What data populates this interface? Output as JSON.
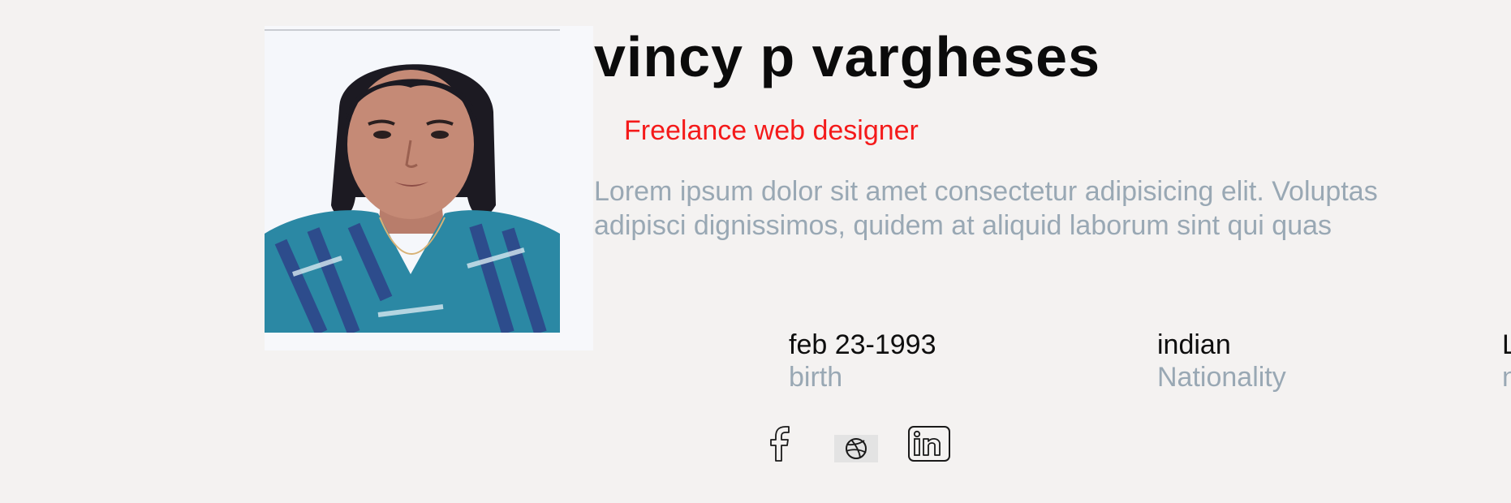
{
  "profile": {
    "name": "vincy p varghese",
    "name_suffix": "s",
    "title": "Freelance web designer",
    "bio_line1": "Lorem ipsum dolor sit amet consectetur adipisicing elit. Voluptas",
    "bio_line2": "adipisci dignissimos, quidem at aliquid laborum sint qui quas"
  },
  "details": [
    {
      "value": "feb 23-1993",
      "label": "birth"
    },
    {
      "value": "indian",
      "label": "Nationality"
    },
    {
      "value": "L",
      "label": "n"
    }
  ],
  "social": [
    {
      "name": "facebook",
      "icon": "facebook-icon"
    },
    {
      "name": "dribbble",
      "icon": "dribbble-icon"
    },
    {
      "name": "linkedin",
      "icon": "linkedin-icon"
    }
  ],
  "colors": {
    "background": "#f4f2f1",
    "name": "#0b0b0b",
    "title_accent": "#f41a1a",
    "muted_text": "#99a8b4"
  }
}
